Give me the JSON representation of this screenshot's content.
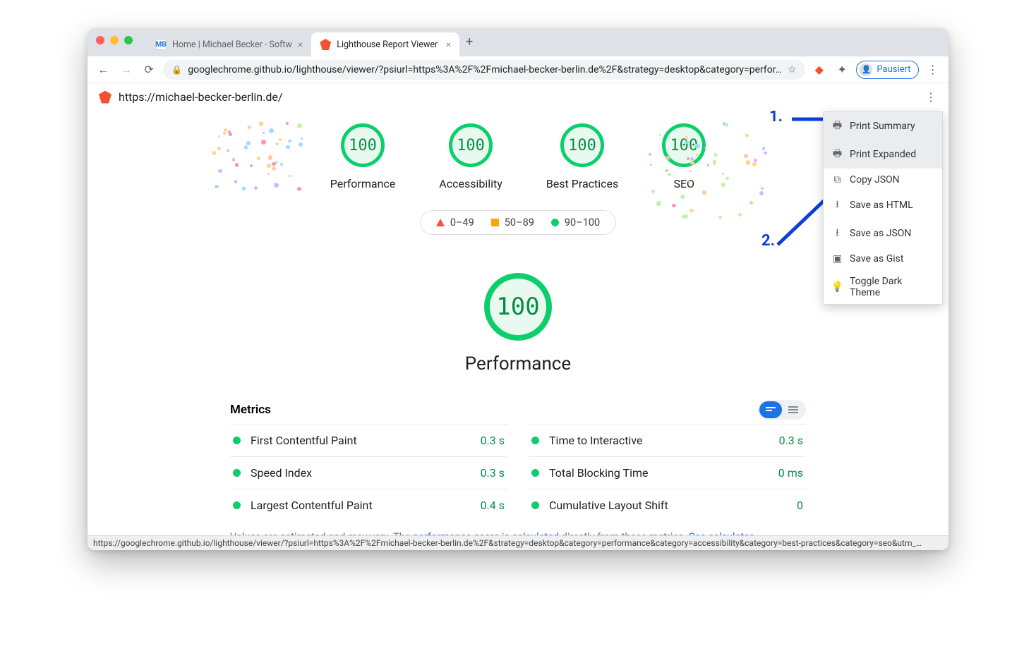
{
  "browser": {
    "tabs": [
      {
        "favText": "MB",
        "favColor": "#1a73e8",
        "favBg": "#fff",
        "title": "Home | Michael Becker - Softw"
      },
      {
        "favText": "",
        "favColor": "#fff",
        "favBg": "#f4512e",
        "title": "Lighthouse Report Viewer"
      }
    ],
    "url": "googlechrome.github.io/lighthouse/viewer/?psiurl=https%3A%2F%2Fmichael-becker-berlin.de%2F&strategy=desktop&category=perfor…",
    "profileLabel": "Pausiert"
  },
  "lighthouse": {
    "siteUrl": "https://michael-becker-berlin.de/",
    "gauges": [
      {
        "score": "100",
        "label": "Performance"
      },
      {
        "score": "100",
        "label": "Accessibility"
      },
      {
        "score": "100",
        "label": "Best Practices"
      },
      {
        "score": "100",
        "label": "SEO"
      }
    ],
    "legend": [
      {
        "range": "0–49"
      },
      {
        "range": "50–89"
      },
      {
        "range": "90–100"
      }
    ],
    "big": {
      "score": "100",
      "label": "Performance"
    },
    "metricsTitle": "Metrics",
    "metrics": [
      {
        "name": "First Contentful Paint",
        "value": "0.3 s"
      },
      {
        "name": "Time to Interactive",
        "value": "0.3 s"
      },
      {
        "name": "Speed Index",
        "value": "0.3 s"
      },
      {
        "name": "Total Blocking Time",
        "value": "0 ms"
      },
      {
        "name": "Largest Contentful Paint",
        "value": "0.4 s"
      },
      {
        "name": "Cumulative Layout Shift",
        "value": "0"
      }
    ],
    "footnote": {
      "pre": "Values are estimated and may vary. The ",
      "link1": "performance score is calculated",
      "mid": " directly from these metrics. ",
      "link2": "See calculator."
    },
    "menu": [
      {
        "icon": "print",
        "label": "Print Summary"
      },
      {
        "icon": "print",
        "label": "Print Expanded"
      },
      {
        "icon": "copy",
        "label": "Copy JSON"
      },
      {
        "icon": "save",
        "label": "Save as HTML"
      },
      {
        "icon": "save",
        "label": "Save as JSON"
      },
      {
        "icon": "gist",
        "label": "Save as Gist"
      },
      {
        "icon": "dark",
        "label": "Toggle Dark Theme"
      }
    ]
  },
  "annotations": {
    "a1": "1.",
    "a2": "2."
  },
  "statusUrl": "https://googlechrome.github.io/lighthouse/viewer/?psiurl=https%3A%2F%2Fmichael-becker-berlin.de%2F&strategy=desktop&category=performance&category=accessibility&category=best-practices&category=seo&utm_…"
}
